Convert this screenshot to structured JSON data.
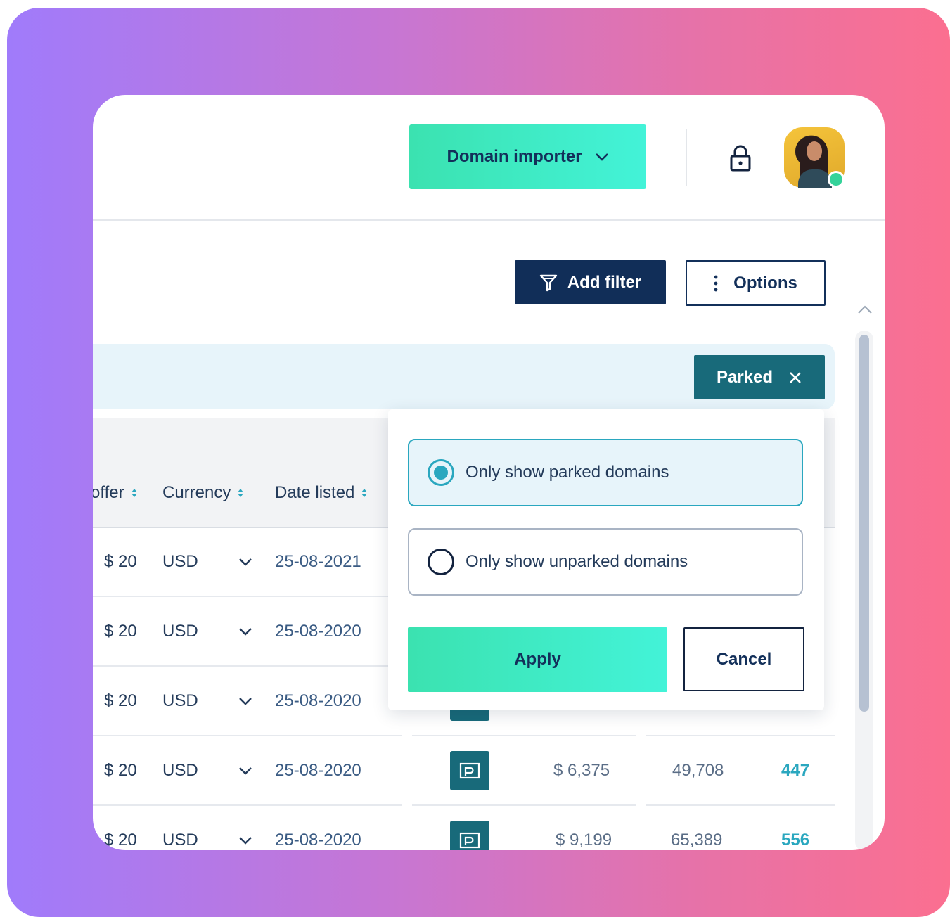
{
  "header": {
    "importer_label": "Domain importer",
    "importer_icon": "chevron-down-icon",
    "lock_icon": "lock-icon",
    "avatar_status": "online",
    "accent_color": "#3be2b0"
  },
  "toolbar": {
    "add_filter_label": "Add filter",
    "add_filter_icon": "filter-icon",
    "options_label": "Options",
    "options_icon": "kebab-icon"
  },
  "filter_chip": {
    "label": "Parked",
    "close_icon": "close-icon"
  },
  "table": {
    "columns": [
      {
        "label": "offer"
      },
      {
        "label": "Currency"
      },
      {
        "label": "Date listed"
      }
    ],
    "rows": [
      {
        "offer": "$ 20",
        "currency": "USD",
        "date": "25-08-2021"
      },
      {
        "offer": "$ 20",
        "currency": "USD",
        "date": "25-08-2020"
      },
      {
        "offer": "$ 20",
        "currency": "USD",
        "date": "25-08-2020"
      },
      {
        "offer": "$ 20",
        "currency": "USD",
        "date": "25-08-2020",
        "value": "$ 6,375",
        "visitors": "49,708",
        "count": "447"
      },
      {
        "offer": "$ 20",
        "currency": "USD",
        "date": "25-08-2020",
        "value": "$ 9,199",
        "visitors": "65,389",
        "count": "556"
      }
    ]
  },
  "popover": {
    "options": [
      {
        "label": "Only show parked domains",
        "selected": true
      },
      {
        "label": "Only show unparked domains",
        "selected": false
      }
    ],
    "apply_label": "Apply",
    "cancel_label": "Cancel"
  }
}
